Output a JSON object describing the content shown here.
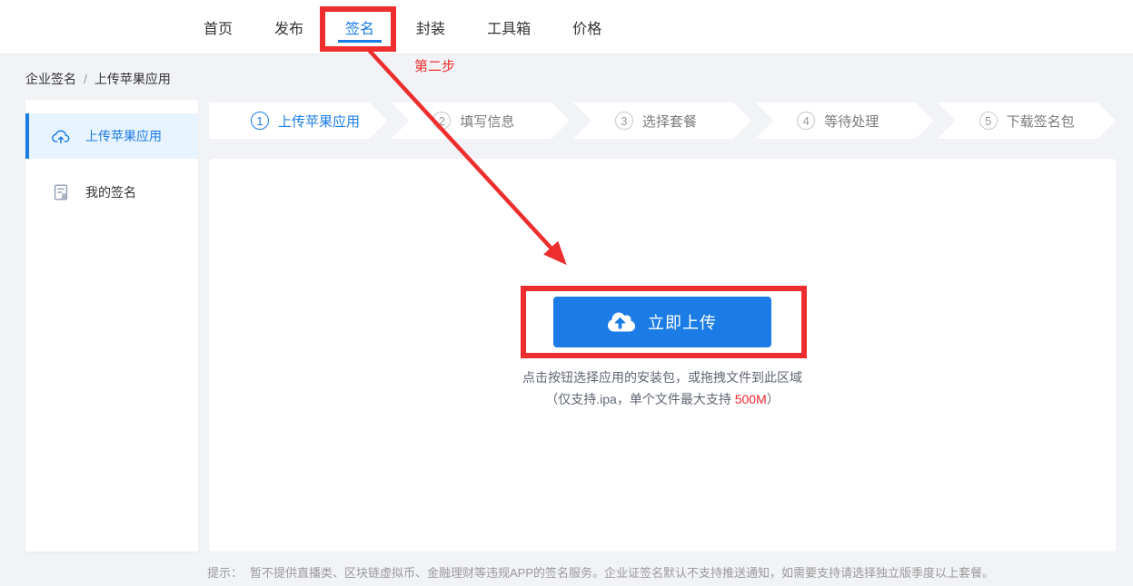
{
  "header": {
    "nav_items": [
      {
        "label": "首页",
        "active": false
      },
      {
        "label": "发布",
        "active": false
      },
      {
        "label": "签名",
        "active": true
      },
      {
        "label": "封装",
        "active": false
      },
      {
        "label": "工具箱",
        "active": false
      },
      {
        "label": "价格",
        "active": false
      }
    ]
  },
  "breadcrumb": {
    "root": "企业签名",
    "separator": "/",
    "current": "上传苹果应用"
  },
  "sidebar": {
    "items": [
      {
        "label": "上传苹果应用",
        "icon": "cloud-upload-icon",
        "active": true
      },
      {
        "label": "我的签名",
        "icon": "signature-doc-icon",
        "active": false
      }
    ]
  },
  "wizard": {
    "steps": [
      {
        "num": "1",
        "label": "上传苹果应用",
        "active": true
      },
      {
        "num": "2",
        "label": "填写信息",
        "active": false
      },
      {
        "num": "3",
        "label": "选择套餐",
        "active": false
      },
      {
        "num": "4",
        "label": "等待处理",
        "active": false
      },
      {
        "num": "5",
        "label": "下载签名包",
        "active": false
      }
    ]
  },
  "upload": {
    "button_label": "立即上传",
    "button_icon": "cloud-upload-icon",
    "hint_line1": "点击按钮选择应用的安装包，或拖拽文件到此区域",
    "hint2_prefix": "（仅支持.ipa，单个文件最大支持 ",
    "hint2_size": "500M",
    "hint2_suffix": "）"
  },
  "tips": {
    "label": "提示：",
    "text": "暂不提供直播类、区块链虚拟币、金融理财等违规APP的签名服务。企业证签名默认不支持推送通知，如需要支持请选择独立版季度以上套餐。"
  },
  "annotations": {
    "step_note": "第二步"
  },
  "colors": {
    "primary_blue": "#1b7ce5",
    "active_item_bg": "#e7f3fe",
    "annotation_red": "#ee2e2e",
    "size_limit_red": "#f5222d",
    "page_bg": "#f1f3f6"
  }
}
